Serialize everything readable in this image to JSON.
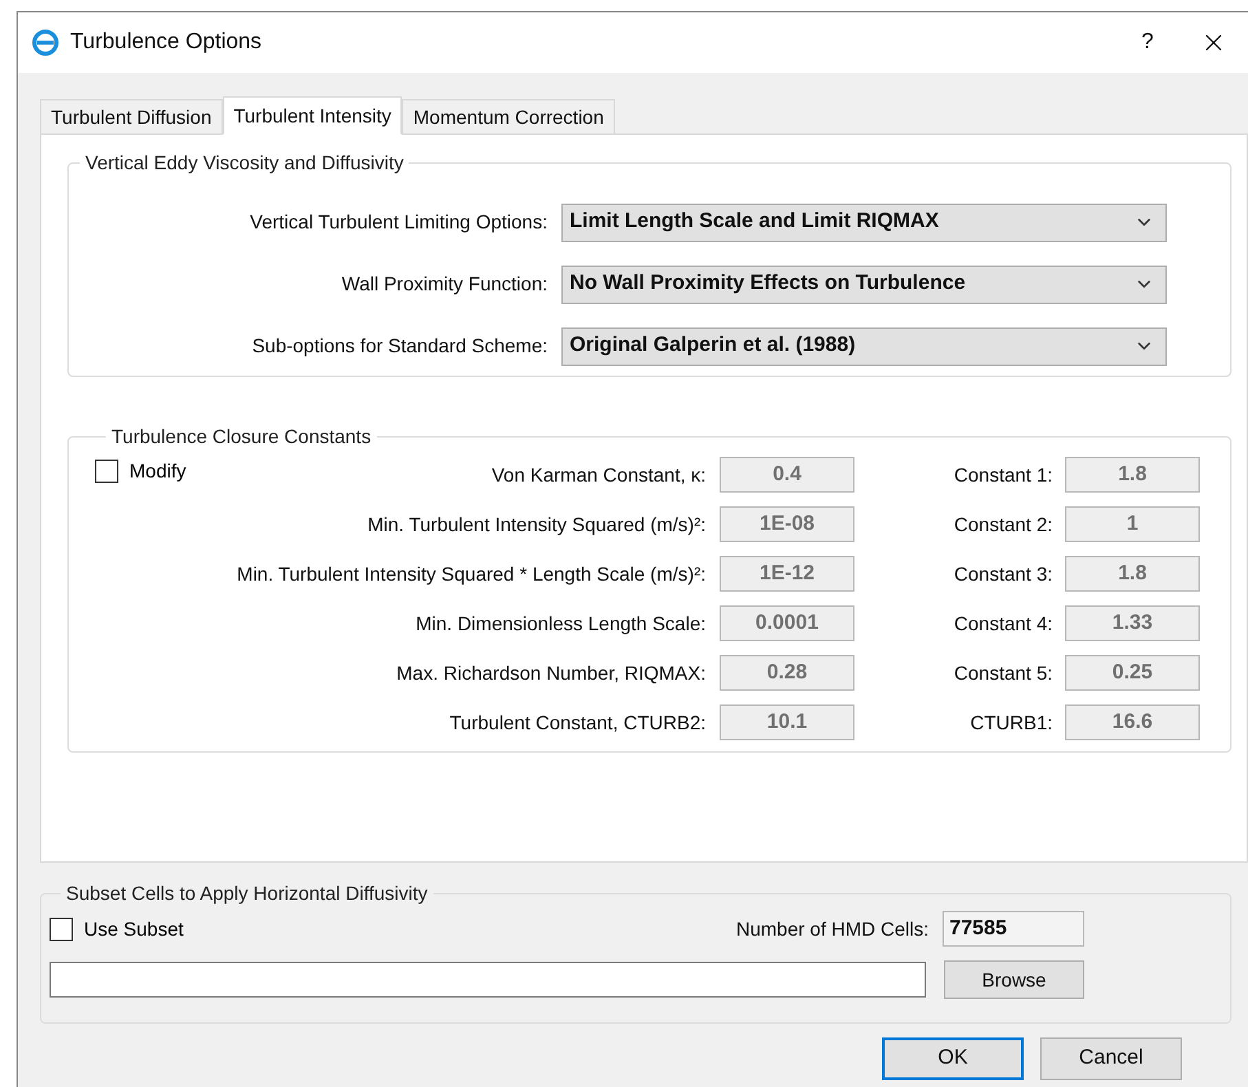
{
  "window": {
    "title": "Turbulence Options",
    "help": "?"
  },
  "tabs": [
    {
      "label": "Turbulent Diffusion",
      "selected": false
    },
    {
      "label": "Turbulent Intensity",
      "selected": true
    },
    {
      "label": "Momentum Correction",
      "selected": false
    }
  ],
  "vertical_group": {
    "title": "Vertical Eddy Viscosity and Diffusivity",
    "dropdowns": [
      {
        "label": "Vertical Turbulent Limiting Options:",
        "value": "Limit Length Scale and Limit RIQMAX"
      },
      {
        "label": "Wall Proximity Function:",
        "value": "No Wall Proximity Effects on Turbulence"
      },
      {
        "label": "Sub-options for Standard Scheme:",
        "value": "Original Galperin et al. (1988)"
      }
    ]
  },
  "closure_group": {
    "title": "Turbulence Closure Constants",
    "values_disabled": true,
    "modify": {
      "label": "Modify",
      "checked": false
    },
    "rows": [
      {
        "label": "Von Karman Constant, κ:",
        "value": "0.4",
        "label_2": "Constant 1:",
        "value_2": "1.8"
      },
      {
        "label": "Min. Turbulent Intensity Squared (m/s)²:",
        "value": "1E-08",
        "label_2": "Constant 2:",
        "value_2": "1"
      },
      {
        "label": "Min. Turbulent Intensity Squared * Length Scale (m/s)²:",
        "value": "1E-12",
        "label_2": "Constant 3:",
        "value_2": "1.8"
      },
      {
        "label": "Min. Dimensionless Length Scale:",
        "value": "0.0001",
        "label_2": "Constant 4:",
        "value_2": "1.33"
      },
      {
        "label": "Max. Richardson Number, RIQMAX:",
        "value": "0.28",
        "label_2": "Constant 5:",
        "value_2": "0.25"
      },
      {
        "label": "Turbulent Constant, CTURB2:",
        "value": "10.1",
        "label_2": "CTURB1:",
        "value_2": "16.6"
      }
    ]
  },
  "subset_group": {
    "title": "Subset Cells to Apply Horizontal Diffusivity",
    "use_subset": {
      "label": "Use Subset",
      "checked": false
    },
    "cells_label": "Number of HMD Cells:",
    "cells_value": "77585",
    "browse": "Browse"
  },
  "buttons": [
    {
      "label": "OK",
      "default": true
    },
    {
      "label": "Cancel",
      "default": false
    }
  ]
}
